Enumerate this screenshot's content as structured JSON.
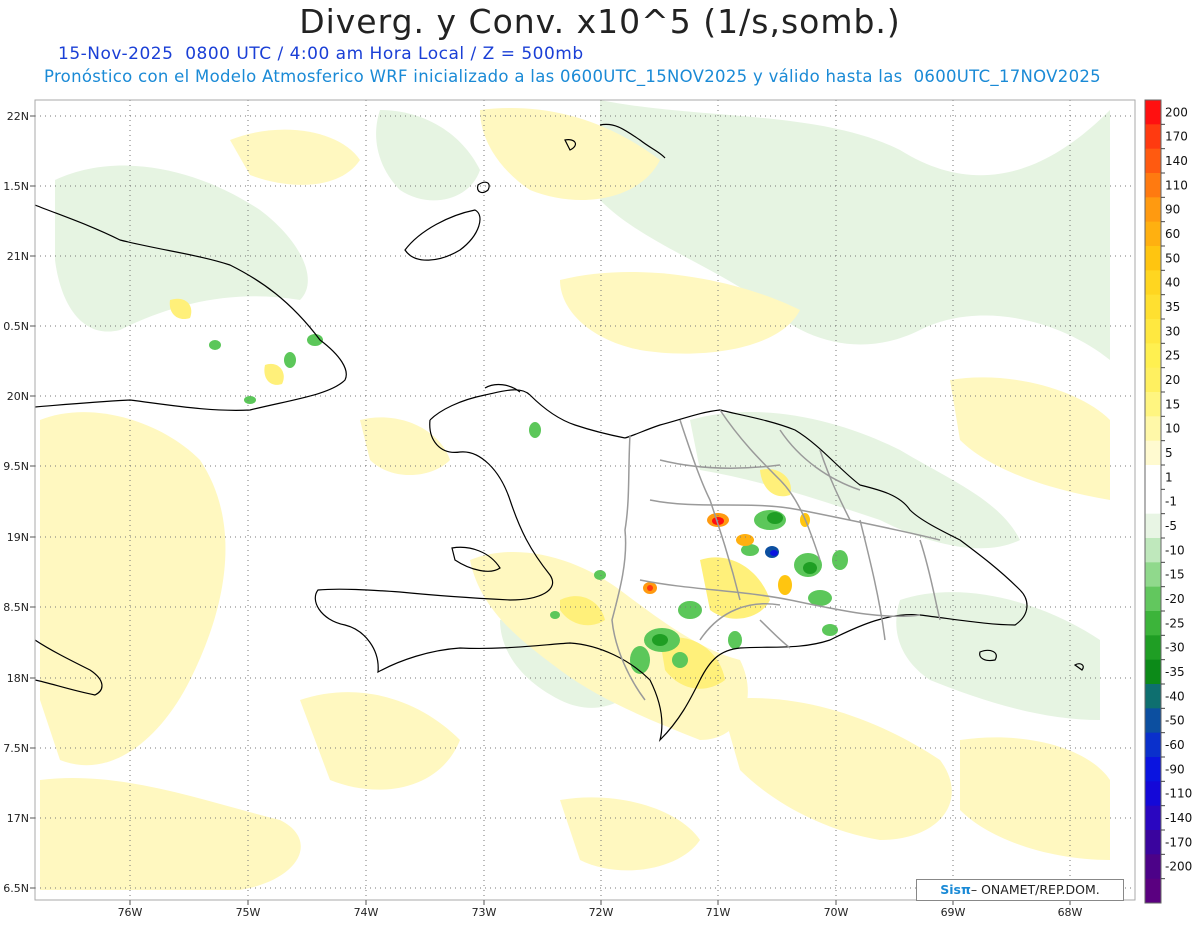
{
  "title": "Diverg. y Conv. x10^5 (1/s,somb.)",
  "subtitle_line1": "15-Nov-2025  0800 UTC / 4:00 am Hora Local / Z = 500mb",
  "subtitle_line2": "Pronóstico con el Modelo Atmosferico WRF inicializado a las 0600UTC_15NOV2025 y válido hasta las  0600UTC_17NOV2025",
  "lat_labels": [
    "22N",
    "1.5N",
    "21N",
    "0.5N",
    "20N",
    "9.5N",
    "19N",
    "8.5N",
    "18N",
    "7.5N",
    "17N",
    "6.5N"
  ],
  "lon_labels": [
    "76W",
    "75W",
    "74W",
    "73W",
    "72W",
    "71W",
    "70W",
    "69W",
    "68W"
  ],
  "colorbar": {
    "labels": [
      "200",
      "170",
      "140",
      "110",
      "90",
      "60",
      "50",
      "40",
      "35",
      "30",
      "25",
      "20",
      "15",
      "10",
      "5",
      "1",
      "-1",
      "-5",
      "-10",
      "-15",
      "-20",
      "-25",
      "-30",
      "-35",
      "-40",
      "-50",
      "-60",
      "-90",
      "-110",
      "-140",
      "-170",
      "-200"
    ],
    "colors": [
      "#ff1010",
      "#ff3a10",
      "#ff5a10",
      "#ff7a10",
      "#ff9a10",
      "#ffb010",
      "#ffc510",
      "#ffd620",
      "#ffe030",
      "#ffe840",
      "#fff050",
      "#fff060",
      "#fff580",
      "#fff8a8",
      "#fffad0",
      "#ffffff",
      "#ffffff",
      "#e8f5e4",
      "#bfe8bc",
      "#90d98c",
      "#62c75e",
      "#3cb43a",
      "#1f9e24",
      "#0c8a18",
      "#0e6f6f",
      "#0c4fa0",
      "#0a30cc",
      "#0a14e0",
      "#1408d8",
      "#2a06c0",
      "#3a049e",
      "#4c0288",
      "#5a0080"
    ]
  },
  "credit": {
    "logo": "Sisπ",
    "text": "– ONAMET/REP.DOM."
  }
}
